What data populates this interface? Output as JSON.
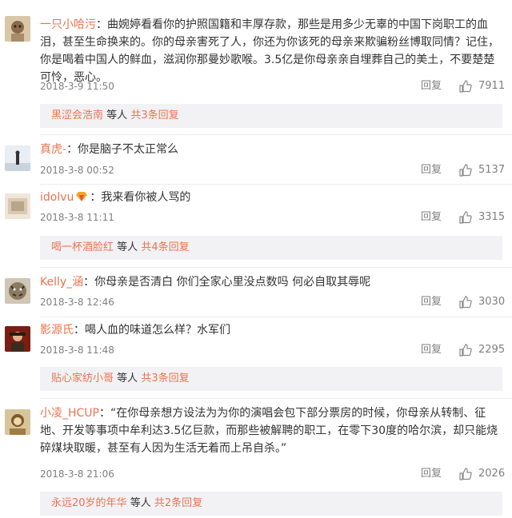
{
  "reply_label": "回复",
  "people_label": "等人",
  "comments": [
    {
      "user": "一只小哈污",
      "text": "：曲婉婷看看你的护照国籍和丰厚存款，那些是用多少无辜的中国下岗职工的血泪，甚至生命换来的。你的母亲害死了人，你还为你该死的母亲来欺骗粉丝博取同情？记住，你是喝着中国人的鲜血，滋润你那曼妙歌喉。3.5亿是你母亲亲自埋葬自己的美土，不要楚楚可怜，恶心。",
      "date": "2018-3-9 11:50",
      "likes": "7911",
      "sub_user": "黑涩会浩南",
      "sub_count": "共3条回复"
    },
    {
      "user": "真虎-",
      "text": "：你是脑子不太正常么",
      "date": "2018-3-8 00:52",
      "likes": "5137"
    },
    {
      "user": "idolvu",
      "text": "：我来看你被人骂的",
      "date": "2018-3-8 11:11",
      "likes": "3315",
      "sub_user": "喝一杯酒脸红",
      "sub_count": "共4条回复"
    },
    {
      "user": "Kelly_涵",
      "text": "：你母亲是否清白 你们全家心里没点数吗 何必自取其辱呢",
      "date": "2018-3-8 12:46",
      "likes": "3030"
    },
    {
      "user": "影源氏",
      "text": "：喝人血的味道怎么样？水军们",
      "date": "2018-3-8 11:48",
      "likes": "2295",
      "sub_user": "贴心家纺小哥",
      "sub_count": "共3条回复"
    },
    {
      "user": "小凌_HCUP",
      "text": "：“在你母亲想方设法为为你的演唱会包下部分票房的时候，你母亲从转制、征地、开发等事项中牟利达3.5亿巨款，而那些被解聘的职工，在零下30度的哈尔滨，却只能烧碎煤块取暖，甚至有人因为生活无着而上吊自杀。”",
      "date": "2018-3-8 21:06",
      "likes": "2026",
      "sub_user": "永远20岁的年华",
      "sub_count": "共2条回复"
    }
  ]
}
